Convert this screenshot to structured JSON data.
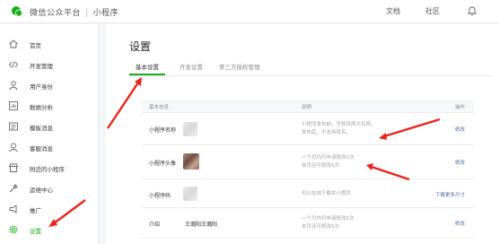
{
  "topbar": {
    "brand": "微信公众平台",
    "product": "小程序",
    "links": [
      "文档",
      "社区"
    ]
  },
  "sidebar": {
    "items": [
      {
        "label": "首页",
        "icon": "home-icon"
      },
      {
        "label": "开发管理",
        "icon": "code-icon"
      },
      {
        "label": "用户身份",
        "icon": "user-icon"
      },
      {
        "label": "数据分析",
        "icon": "chart-icon"
      },
      {
        "label": "模板消息",
        "icon": "message-icon"
      },
      {
        "label": "客服消息",
        "icon": "support-icon"
      },
      {
        "label": "附近的小程序",
        "icon": "store-icon"
      },
      {
        "label": "运维中心",
        "icon": "wrench-icon"
      },
      {
        "label": "推广",
        "icon": "promote-icon"
      },
      {
        "label": "设置",
        "icon": "gear-icon",
        "active": true
      }
    ]
  },
  "main": {
    "title": "设置",
    "tabs": [
      "基本设置",
      "开发设置",
      "第三方授权管理"
    ],
    "table": {
      "headers": [
        "基本信息",
        "说明",
        "操作"
      ],
      "rows": [
        {
          "label": "小程序名称",
          "desc": [
            "小程序发布前，可修改两次名称。",
            "发布后，不支持改名。"
          ],
          "op": "修改"
        },
        {
          "label": "小程序头像",
          "desc": [
            "一个月内可申请修改5次",
            "本月还可修改5次"
          ],
          "op": "修改"
        },
        {
          "label": "小程序码",
          "desc": [
            "可以在线下载本小程序"
          ],
          "op": "下载更多尺寸"
        },
        {
          "label": "介绍",
          "value": "王瀚阳王瀚阳",
          "desc": [
            "一个月内可申请修改5次",
            "本月还可修改5次"
          ],
          "op": "修改"
        }
      ]
    }
  },
  "colors": {
    "accent_green": "#1aad19",
    "link_blue": "#576b95",
    "annotation_red": "#e8241c"
  }
}
